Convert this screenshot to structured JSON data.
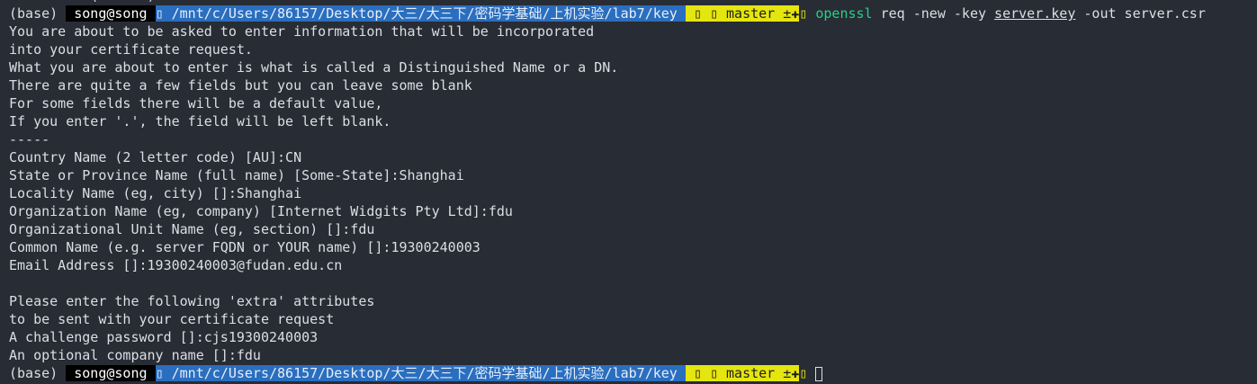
{
  "top_cut_line": "  ... ... (......)",
  "prompt": {
    "env": "(base) ",
    "user": " song@song ",
    "path": "▯ /mnt/c/Users/86157/Desktop/大三/大三下/密码学基础/上机实验/lab7/key ",
    "git": " ▯ ▯ master ±✚",
    "separator": "▯ "
  },
  "command": {
    "program": "openssl",
    "args1": " req -new -key ",
    "keyfile": "server.key",
    "args2": " -out server.csr"
  },
  "output_lines": [
    "You are about to be asked to enter information that will be incorporated",
    "into your certificate request.",
    "What you are about to enter is what is called a Distinguished Name or a DN.",
    "There are quite a few fields but you can leave some blank",
    "For some fields there will be a default value,",
    "If you enter '.', the field will be left blank.",
    "-----",
    "Country Name (2 letter code) [AU]:CN",
    "State or Province Name (full name) [Some-State]:Shanghai",
    "Locality Name (eg, city) []:Shanghai",
    "Organization Name (eg, company) [Internet Widgits Pty Ltd]:fdu",
    "Organizational Unit Name (eg, section) []:fdu",
    "Common Name (e.g. server FQDN or YOUR name) []:19300240003",
    "Email Address []:19300240003@fudan.edu.cn",
    "",
    "Please enter the following 'extra' attributes",
    "to be sent with your certificate request",
    "A challenge password []:cjs19300240003",
    "An optional company name []:fdu"
  ]
}
